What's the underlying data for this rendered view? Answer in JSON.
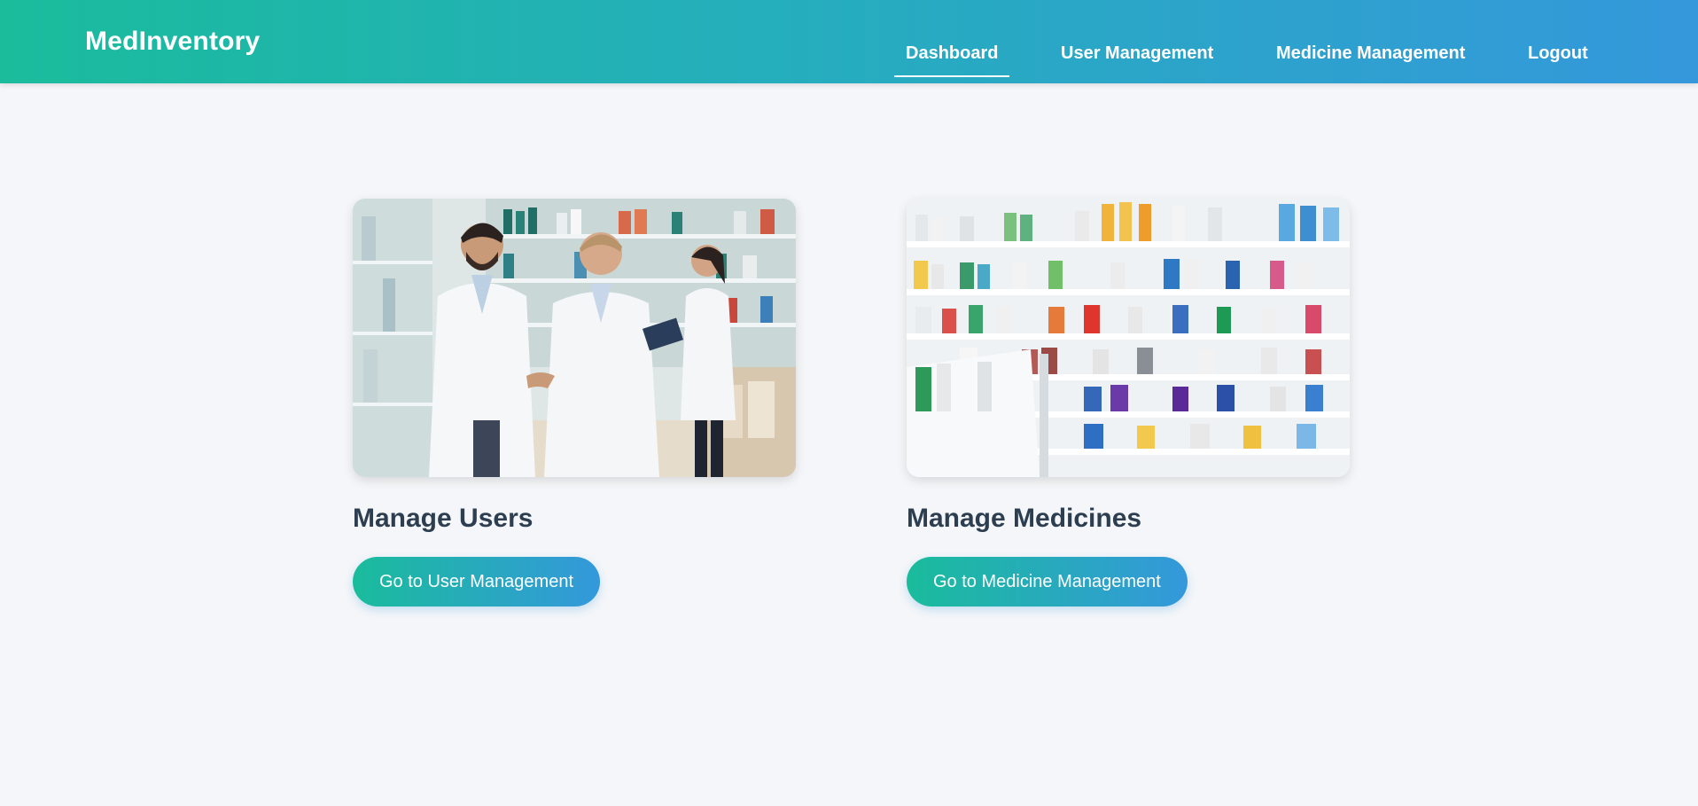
{
  "header": {
    "brand": "MedInventory",
    "nav": [
      {
        "label": "Dashboard",
        "active": true
      },
      {
        "label": "User Management",
        "active": false
      },
      {
        "label": "Medicine Management",
        "active": false
      },
      {
        "label": "Logout",
        "active": false
      }
    ]
  },
  "cards": [
    {
      "title": "Manage Users",
      "button_label": "Go to User Management",
      "image": "pharmacists-handshake-photo"
    },
    {
      "title": "Manage Medicines",
      "button_label": "Go to Medicine Management",
      "image": "pharmacy-shelves-photo"
    }
  ],
  "colors": {
    "brand_start": "#1abc9c",
    "brand_end": "#3498db",
    "page_bg": "#f4f6f9",
    "heading_text": "#2c3e50"
  }
}
